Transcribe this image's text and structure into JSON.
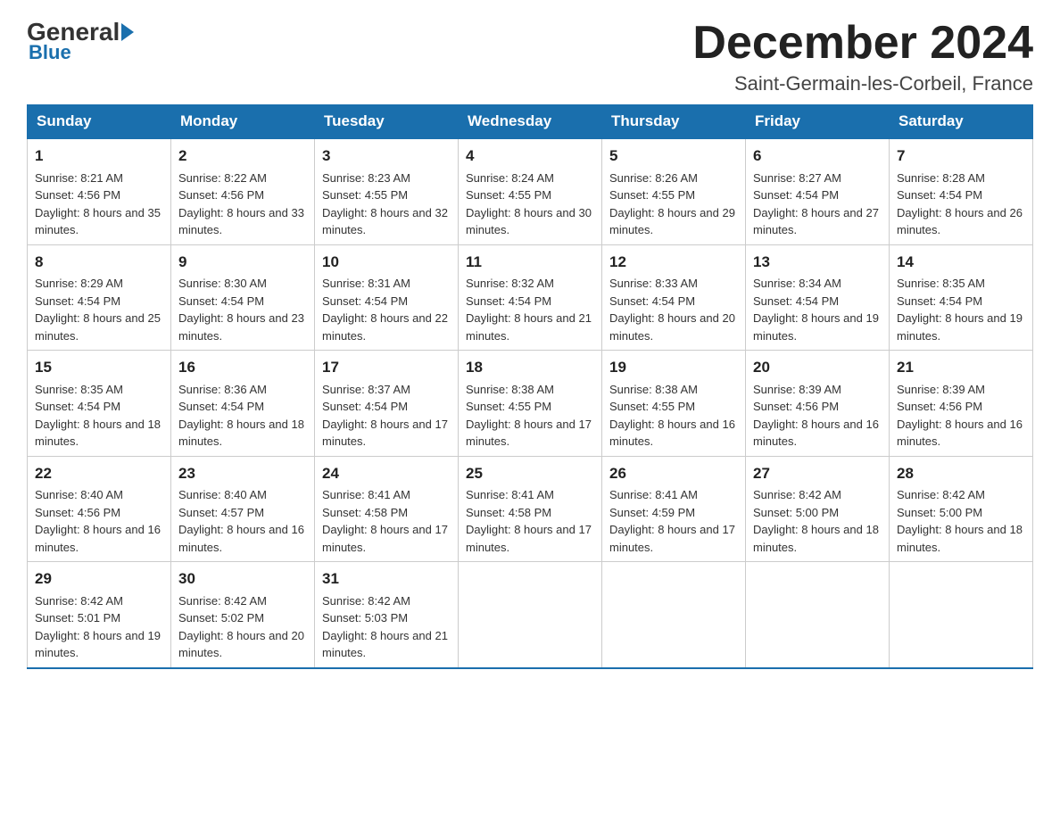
{
  "logo": {
    "general": "General",
    "blue": "Blue"
  },
  "header": {
    "month": "December 2024",
    "location": "Saint-Germain-les-Corbeil, France"
  },
  "weekdays": [
    "Sunday",
    "Monday",
    "Tuesday",
    "Wednesday",
    "Thursday",
    "Friday",
    "Saturday"
  ],
  "weeks": [
    [
      {
        "day": "1",
        "sunrise": "8:21 AM",
        "sunset": "4:56 PM",
        "daylight": "8 hours and 35 minutes."
      },
      {
        "day": "2",
        "sunrise": "8:22 AM",
        "sunset": "4:56 PM",
        "daylight": "8 hours and 33 minutes."
      },
      {
        "day": "3",
        "sunrise": "8:23 AM",
        "sunset": "4:55 PM",
        "daylight": "8 hours and 32 minutes."
      },
      {
        "day": "4",
        "sunrise": "8:24 AM",
        "sunset": "4:55 PM",
        "daylight": "8 hours and 30 minutes."
      },
      {
        "day": "5",
        "sunrise": "8:26 AM",
        "sunset": "4:55 PM",
        "daylight": "8 hours and 29 minutes."
      },
      {
        "day": "6",
        "sunrise": "8:27 AM",
        "sunset": "4:54 PM",
        "daylight": "8 hours and 27 minutes."
      },
      {
        "day": "7",
        "sunrise": "8:28 AM",
        "sunset": "4:54 PM",
        "daylight": "8 hours and 26 minutes."
      }
    ],
    [
      {
        "day": "8",
        "sunrise": "8:29 AM",
        "sunset": "4:54 PM",
        "daylight": "8 hours and 25 minutes."
      },
      {
        "day": "9",
        "sunrise": "8:30 AM",
        "sunset": "4:54 PM",
        "daylight": "8 hours and 23 minutes."
      },
      {
        "day": "10",
        "sunrise": "8:31 AM",
        "sunset": "4:54 PM",
        "daylight": "8 hours and 22 minutes."
      },
      {
        "day": "11",
        "sunrise": "8:32 AM",
        "sunset": "4:54 PM",
        "daylight": "8 hours and 21 minutes."
      },
      {
        "day": "12",
        "sunrise": "8:33 AM",
        "sunset": "4:54 PM",
        "daylight": "8 hours and 20 minutes."
      },
      {
        "day": "13",
        "sunrise": "8:34 AM",
        "sunset": "4:54 PM",
        "daylight": "8 hours and 19 minutes."
      },
      {
        "day": "14",
        "sunrise": "8:35 AM",
        "sunset": "4:54 PM",
        "daylight": "8 hours and 19 minutes."
      }
    ],
    [
      {
        "day": "15",
        "sunrise": "8:35 AM",
        "sunset": "4:54 PM",
        "daylight": "8 hours and 18 minutes."
      },
      {
        "day": "16",
        "sunrise": "8:36 AM",
        "sunset": "4:54 PM",
        "daylight": "8 hours and 18 minutes."
      },
      {
        "day": "17",
        "sunrise": "8:37 AM",
        "sunset": "4:54 PM",
        "daylight": "8 hours and 17 minutes."
      },
      {
        "day": "18",
        "sunrise": "8:38 AM",
        "sunset": "4:55 PM",
        "daylight": "8 hours and 17 minutes."
      },
      {
        "day": "19",
        "sunrise": "8:38 AM",
        "sunset": "4:55 PM",
        "daylight": "8 hours and 16 minutes."
      },
      {
        "day": "20",
        "sunrise": "8:39 AM",
        "sunset": "4:56 PM",
        "daylight": "8 hours and 16 minutes."
      },
      {
        "day": "21",
        "sunrise": "8:39 AM",
        "sunset": "4:56 PM",
        "daylight": "8 hours and 16 minutes."
      }
    ],
    [
      {
        "day": "22",
        "sunrise": "8:40 AM",
        "sunset": "4:56 PM",
        "daylight": "8 hours and 16 minutes."
      },
      {
        "day": "23",
        "sunrise": "8:40 AM",
        "sunset": "4:57 PM",
        "daylight": "8 hours and 16 minutes."
      },
      {
        "day": "24",
        "sunrise": "8:41 AM",
        "sunset": "4:58 PM",
        "daylight": "8 hours and 17 minutes."
      },
      {
        "day": "25",
        "sunrise": "8:41 AM",
        "sunset": "4:58 PM",
        "daylight": "8 hours and 17 minutes."
      },
      {
        "day": "26",
        "sunrise": "8:41 AM",
        "sunset": "4:59 PM",
        "daylight": "8 hours and 17 minutes."
      },
      {
        "day": "27",
        "sunrise": "8:42 AM",
        "sunset": "5:00 PM",
        "daylight": "8 hours and 18 minutes."
      },
      {
        "day": "28",
        "sunrise": "8:42 AM",
        "sunset": "5:00 PM",
        "daylight": "8 hours and 18 minutes."
      }
    ],
    [
      {
        "day": "29",
        "sunrise": "8:42 AM",
        "sunset": "5:01 PM",
        "daylight": "8 hours and 19 minutes."
      },
      {
        "day": "30",
        "sunrise": "8:42 AM",
        "sunset": "5:02 PM",
        "daylight": "8 hours and 20 minutes."
      },
      {
        "day": "31",
        "sunrise": "8:42 AM",
        "sunset": "5:03 PM",
        "daylight": "8 hours and 21 minutes."
      },
      null,
      null,
      null,
      null
    ]
  ],
  "labels": {
    "sunrise_prefix": "Sunrise: ",
    "sunset_prefix": "Sunset: ",
    "daylight_prefix": "Daylight: "
  }
}
